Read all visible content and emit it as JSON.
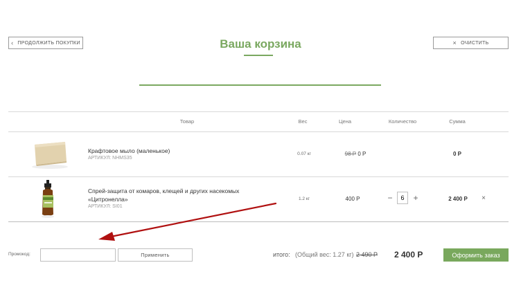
{
  "header": {
    "continue_label": "ПРОДОЛЖИТЬ ПОКУПКИ",
    "title": "Ваша корзина",
    "clear_label": "ОЧИСТИТЬ"
  },
  "table": {
    "headers": [
      "Товар",
      "Вес",
      "Цена",
      "Количество",
      "Сумма"
    ]
  },
  "items": [
    {
      "name": "Крафтовое мыло (маленькое)",
      "sku": "АРТИКУЛ: NHMS35",
      "weight": "0.07 кг",
      "old_price": "98 Р",
      "price": "0 Р",
      "sum": "0 Р"
    },
    {
      "name_line1": "Спрей-защита от комаров, клещей и других насекомых",
      "name_line2": "«Цитронелла»",
      "sku": "АРТИКУЛ: SI01",
      "weight": "1.2 кг",
      "price": "400 Р",
      "quantity": "6",
      "minus": "−",
      "plus": "+",
      "sum": "2 400 Р",
      "remove": "×"
    }
  ],
  "footer": {
    "promo_label": "Промокод:",
    "promo_value": "",
    "apply_label": "Применить",
    "total_label": "итого:",
    "total_weight": "(Общий вес: 1.27 кг)",
    "old_total": "2 490 Р",
    "total": "2 400 Р",
    "checkout_label": "Оформить заказ"
  },
  "colors": {
    "accent": "#79a85d",
    "annotation_arrow": "#b01010"
  }
}
